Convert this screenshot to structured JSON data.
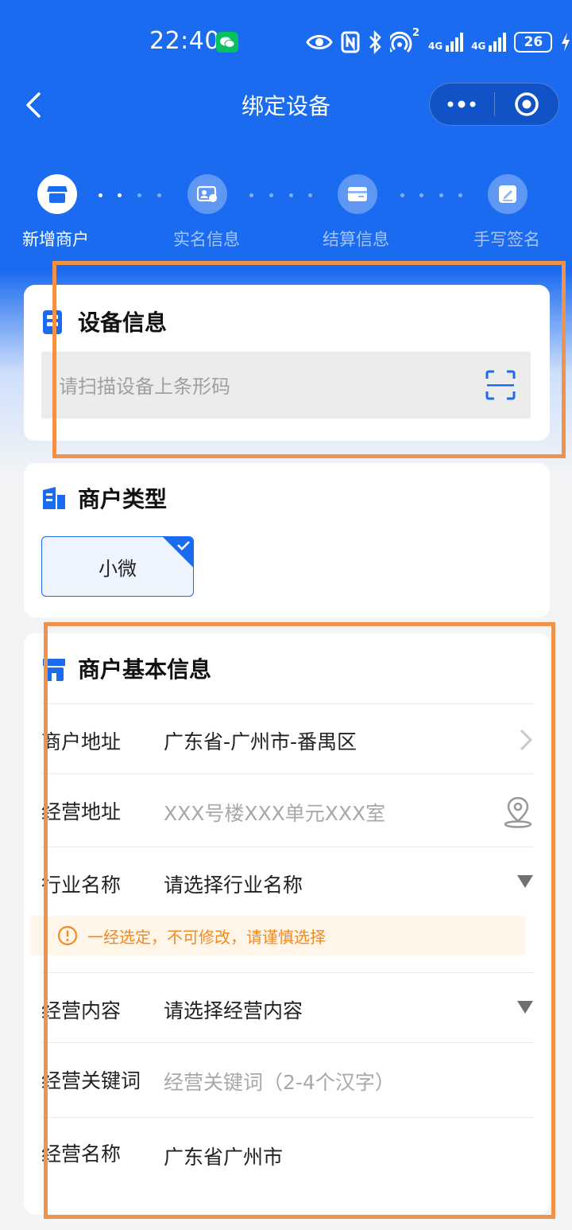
{
  "status_bar": {
    "time": "22:40",
    "battery": "26",
    "net_1": "4G",
    "net_2": "4G",
    "hotspot_count": "2"
  },
  "nav": {
    "title": "绑定设备"
  },
  "steps": [
    {
      "label": "新增商户",
      "active": true,
      "icon": "store-icon"
    },
    {
      "label": "实名信息",
      "active": false,
      "icon": "id-card-icon"
    },
    {
      "label": "结算信息",
      "active": false,
      "icon": "bank-card-icon"
    },
    {
      "label": "手写签名",
      "active": false,
      "icon": "signature-icon"
    }
  ],
  "device_card": {
    "title": "设备信息",
    "scan_placeholder": "请扫描设备上条形码"
  },
  "merchant_type": {
    "title": "商户类型",
    "option": "小微",
    "selected": true
  },
  "merchant_info": {
    "title": "商户基本信息",
    "rows": [
      {
        "label": "商户地址",
        "value": "广东省-广州市-番禺区",
        "placeholder": false,
        "control": "chevron-right-icon"
      },
      {
        "label": "经营地址",
        "value": "XXX号楼XXX单元XXX室",
        "placeholder": true,
        "control": "location-pin-icon"
      },
      {
        "label": "行业名称",
        "value": "请选择行业名称",
        "placeholder": false,
        "control": "dropdown-triangle-icon"
      },
      {
        "label": "经营内容",
        "value": "请选择经营内容",
        "placeholder": false,
        "control": "dropdown-triangle-icon"
      },
      {
        "label": "经营关键词",
        "value": "经营关键词（2-4个汉字）",
        "placeholder": true,
        "control": ""
      },
      {
        "label": "经营名称",
        "value": "广东省广州市",
        "placeholder": false,
        "control": ""
      }
    ],
    "warning": "一经选定，不可修改，请谨慎选择"
  },
  "colors": {
    "brand_blue": "#1b6bf0",
    "warning_orange": "#f08a24",
    "highlight_box": "#f0924a"
  }
}
